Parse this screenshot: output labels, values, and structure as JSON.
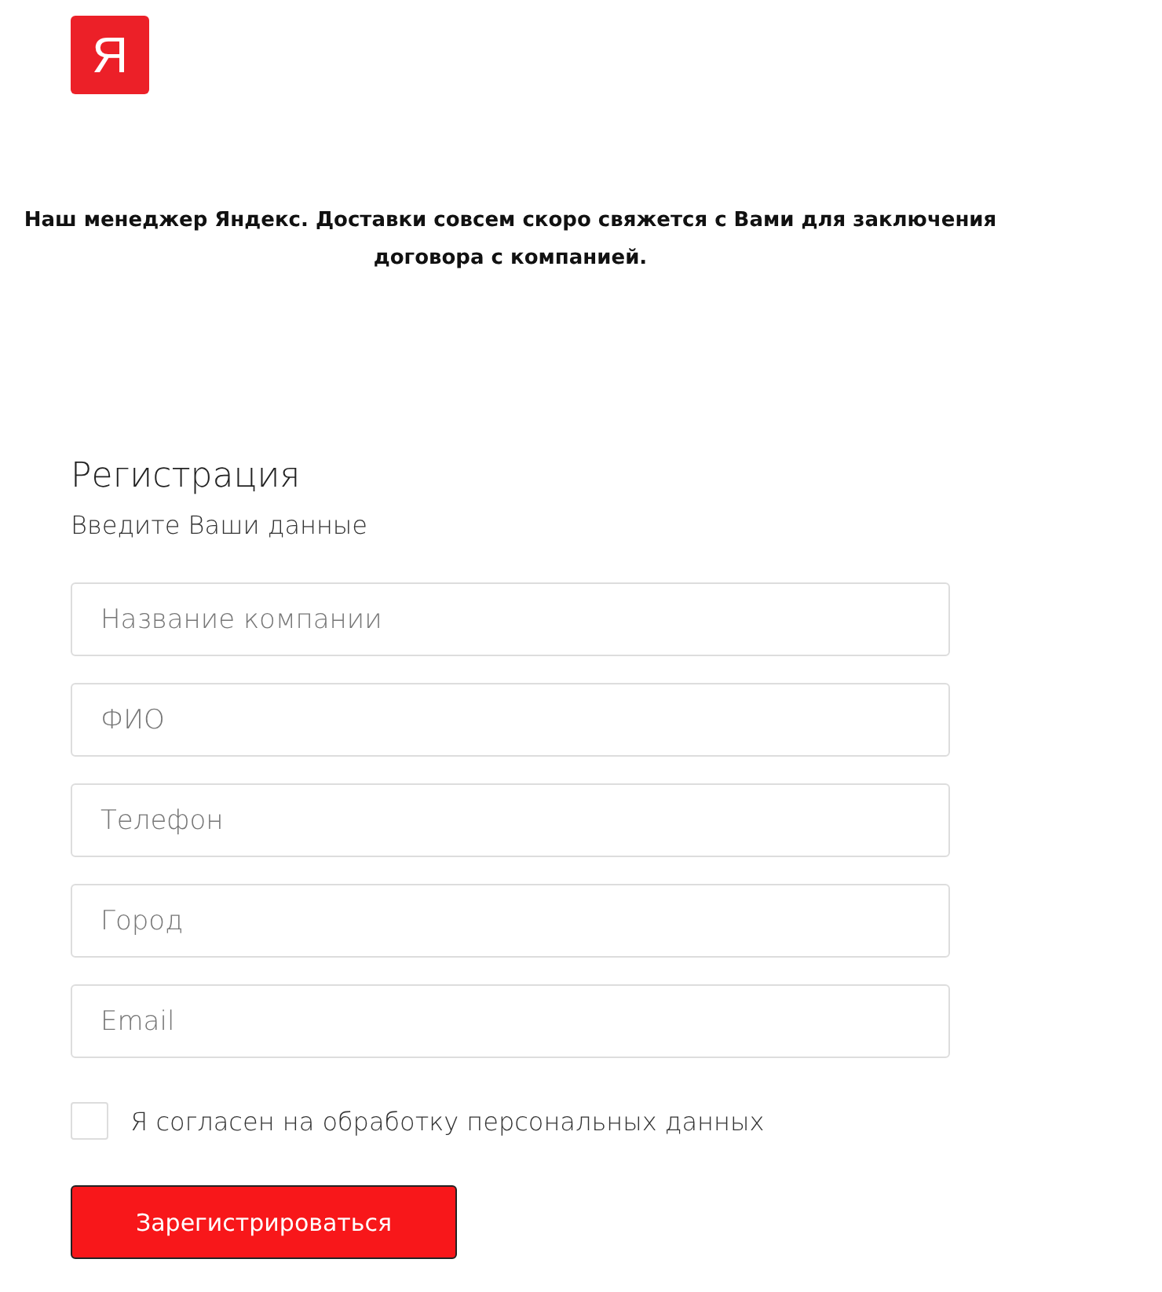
{
  "logo": {
    "text": "Я"
  },
  "notice": "Наш менеджер Яндекс. Доставки совсем скоро свяжется с Вами для заключения договора с компанией.",
  "form": {
    "title": "Регистрация",
    "subtitle": "Введите Ваши данные",
    "fields": [
      {
        "placeholder": "Название компании"
      },
      {
        "placeholder": "ФИО"
      },
      {
        "placeholder": "Телефон"
      },
      {
        "placeholder": "Город"
      },
      {
        "placeholder": "Email"
      }
    ],
    "consent": {
      "label": "Я согласен на обработку персональных данных",
      "checked": false
    },
    "submit": "Зарегистрироваться"
  }
}
